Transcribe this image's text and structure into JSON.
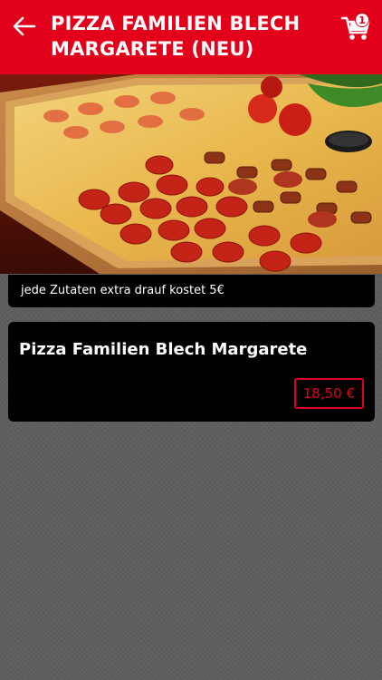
{
  "header": {
    "title": "PIZZA FAMILIEN BLECH MARGARETE (NEU)",
    "back_icon": "arrow-left-icon",
    "cart_icon": "shopping-cart-icon",
    "cart_count": "1"
  },
  "hero": {
    "image": "rectangular pizza tray with cheese, pepperoni and sausage toppings"
  },
  "info": {
    "text": "jede Zutaten extra drauf kostet 5€"
  },
  "product": {
    "name": "Pizza Familien Blech Margarete",
    "price": "18,50 €"
  },
  "colors": {
    "header_bg": "#e3001b",
    "accent": "#e3001b",
    "card_bg": "#000000",
    "page_bg": "#5e5e5e"
  }
}
